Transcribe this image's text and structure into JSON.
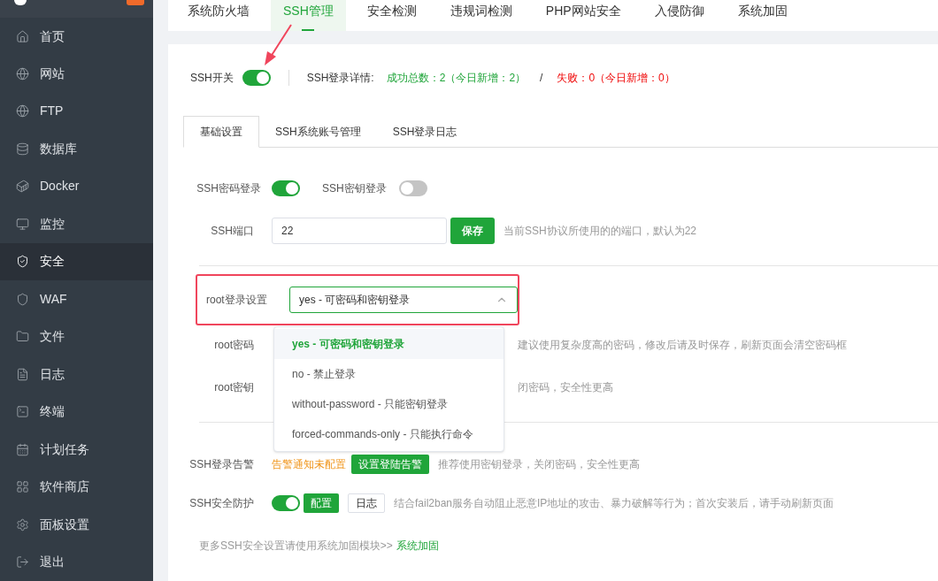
{
  "sidebar": {
    "items": [
      {
        "label": "首页",
        "selected": false
      },
      {
        "label": "网站",
        "selected": false
      },
      {
        "label": "FTP",
        "selected": false
      },
      {
        "label": "数据库",
        "selected": false
      },
      {
        "label": "Docker",
        "selected": false
      },
      {
        "label": "监控",
        "selected": false
      },
      {
        "label": "安全",
        "selected": true
      },
      {
        "label": "WAF",
        "selected": false
      },
      {
        "label": "文件",
        "selected": false
      },
      {
        "label": "日志",
        "selected": false
      },
      {
        "label": "终端",
        "selected": false
      },
      {
        "label": "计划任务",
        "selected": false
      },
      {
        "label": "软件商店",
        "selected": false
      },
      {
        "label": "面板设置",
        "selected": false
      },
      {
        "label": "退出",
        "selected": false
      }
    ]
  },
  "top_tabs": [
    {
      "label": "系统防火墙",
      "selected": false
    },
    {
      "label": "SSH管理",
      "selected": true
    },
    {
      "label": "安全检测",
      "selected": false
    },
    {
      "label": "违规词检测",
      "selected": false
    },
    {
      "label": "PHP网站安全",
      "selected": false
    },
    {
      "label": "入侵防御",
      "selected": false
    },
    {
      "label": "系统加固",
      "selected": false
    }
  ],
  "ssh_switch": {
    "label": "SSH开关",
    "on": true
  },
  "login_details": {
    "label": "SSH登录详情:",
    "success": "成功总数：2（今日新增：2）",
    "separator": "/",
    "failure": "失败：0（今日新增：0）"
  },
  "sub_tabs": [
    {
      "label": "基础设置",
      "selected": true
    },
    {
      "label": "SSH系统账号管理",
      "selected": false
    },
    {
      "label": "SSH登录日志",
      "selected": false
    }
  ],
  "password_login": {
    "label": "SSH密码登录",
    "on": true
  },
  "key_login": {
    "label": "SSH密钥登录",
    "on": false
  },
  "port": {
    "label": "SSH端口",
    "value": "22",
    "button": "保存",
    "hint": "当前SSH协议所使用的的端口，默认为22"
  },
  "root_login": {
    "label": "root登录设置",
    "value": "yes - 可密码和密钥登录",
    "expanded": true,
    "options": [
      {
        "label": "yes - 可密码和密钥登录",
        "selected": true
      },
      {
        "label": "no - 禁止登录",
        "selected": false
      },
      {
        "label": "without-password - 只能密钥登录",
        "selected": false
      },
      {
        "label": "forced-commands-only - 只能执行命令",
        "selected": false
      }
    ]
  },
  "root_password": {
    "label": "root密码",
    "hint": "建议使用复杂度高的密码，修改后请及时保存，刷新页面会清空密码框"
  },
  "root_key": {
    "label": "root密钥",
    "hint": "闭密码，安全性更高"
  },
  "login_alert": {
    "label": "SSH登录告警",
    "status": "告警通知未配置",
    "button": "设置登陆告警",
    "hint": "推荐使用密钥登录，关闭密码，安全性更高"
  },
  "protection": {
    "label": "SSH安全防护",
    "on": true,
    "config_button": "配置",
    "log_button": "日志",
    "hint": "结合fail2ban服务自动阻止恶意IP地址的攻击、暴力破解等行为；首次安装后，请手动刷新页面"
  },
  "footer": {
    "text": "更多SSH安全设置请使用系统加固模块>>",
    "link": "系统加固"
  }
}
